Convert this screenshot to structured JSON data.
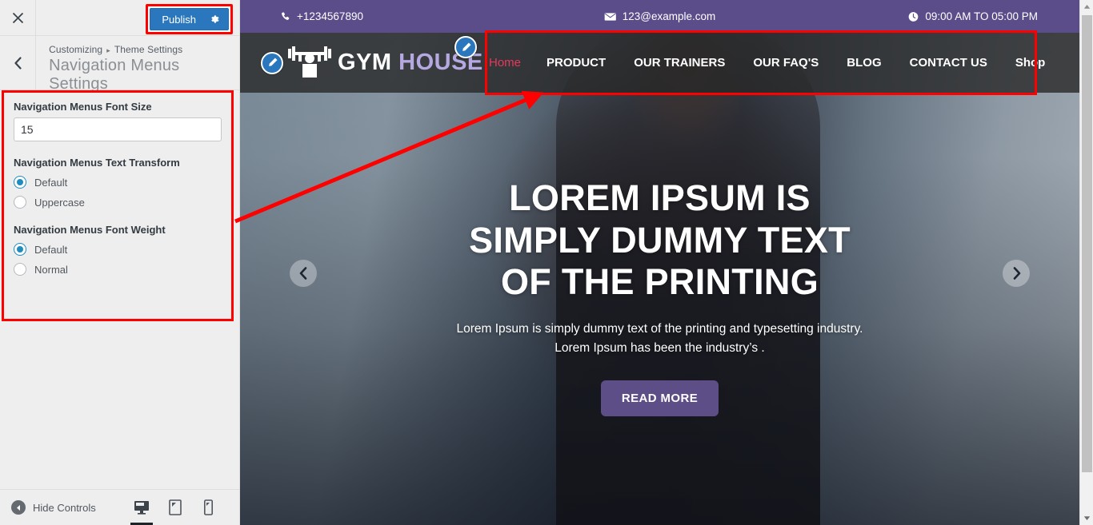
{
  "customizer": {
    "close_icon": "close-icon",
    "publish_label": "Publish",
    "publish_gear_icon": "gear-icon",
    "back_icon": "chevron-left-icon",
    "breadcrumb": {
      "root": "Customizing",
      "separator": "▸",
      "section": "Theme Settings"
    },
    "panel_title": "Navigation Menus Settings",
    "controls": [
      {
        "type": "text",
        "label": "Navigation Menus Font Size",
        "value": "15",
        "placeholder": ""
      },
      {
        "type": "radio",
        "label": "Navigation Menus Text Transform",
        "options": [
          {
            "label": "Default",
            "checked": true
          },
          {
            "label": "Uppercase",
            "checked": false
          }
        ]
      },
      {
        "type": "radio",
        "label": "Navigation Menus Font Weight",
        "options": [
          {
            "label": "Default",
            "checked": true
          },
          {
            "label": "Normal",
            "checked": false
          }
        ]
      }
    ],
    "footer": {
      "hide_controls_label": "Hide Controls",
      "hide_controls_icon": "caret-left-circle-icon",
      "devices": [
        {
          "name": "desktop-icon",
          "active": true
        },
        {
          "name": "tablet-icon",
          "active": false
        },
        {
          "name": "mobile-icon",
          "active": false
        }
      ]
    }
  },
  "preview": {
    "topbar": {
      "phone_icon": "phone-icon",
      "phone": "+1234567890",
      "email_icon": "envelope-icon",
      "email": "123@example.com",
      "clock_icon": "clock-icon",
      "hours": "09:00 AM TO 05:00 PM"
    },
    "logo": {
      "icon": "barbell-lifter-icon",
      "text_primary": "GYM ",
      "text_secondary": "HOUSE",
      "edit_icon": "pencil-edit-icon"
    },
    "nav": {
      "edit_icon": "pencil-edit-icon",
      "items": [
        {
          "label": "Home",
          "current": true
        },
        {
          "label": "PRODUCT",
          "current": false
        },
        {
          "label": "OUR TRAINERS",
          "current": false
        },
        {
          "label": "OUR FAQ'S",
          "current": false
        },
        {
          "label": "BLOG",
          "current": false
        },
        {
          "label": "CONTACT US",
          "current": false
        },
        {
          "label": "Shop",
          "current": false
        }
      ]
    },
    "hero": {
      "title_line1": "LOREM IPSUM IS",
      "title_line2": "SIMPLY DUMMY TEXT",
      "title_line3": "OF THE PRINTING",
      "subtitle_line1": "Lorem Ipsum is simply dummy text of the printing and typesetting industry.",
      "subtitle_line2": "Lorem Ipsum has been the industry’s .",
      "cta_label": "READ MORE",
      "prev_icon": "chevron-left-circle-icon",
      "next_icon": "chevron-right-circle-icon"
    },
    "scrollbar": {
      "up_icon": "scroll-up-icon",
      "down_icon": "scroll-down-icon"
    }
  },
  "annotations": {
    "accent_color": "#ff0000",
    "arrow_icon": "pointer-arrow-icon"
  },
  "colors": {
    "publish_blue": "#2b77bd",
    "topbar_purple": "#5b4d8a",
    "nav_dark": "#282828",
    "active_link": "#e8385a",
    "cta_purple": "#5e4e87",
    "logo_secondary": "#b6a8e0",
    "annotation_red": "#ff0000",
    "radio_blue": "#1e8cbe"
  }
}
